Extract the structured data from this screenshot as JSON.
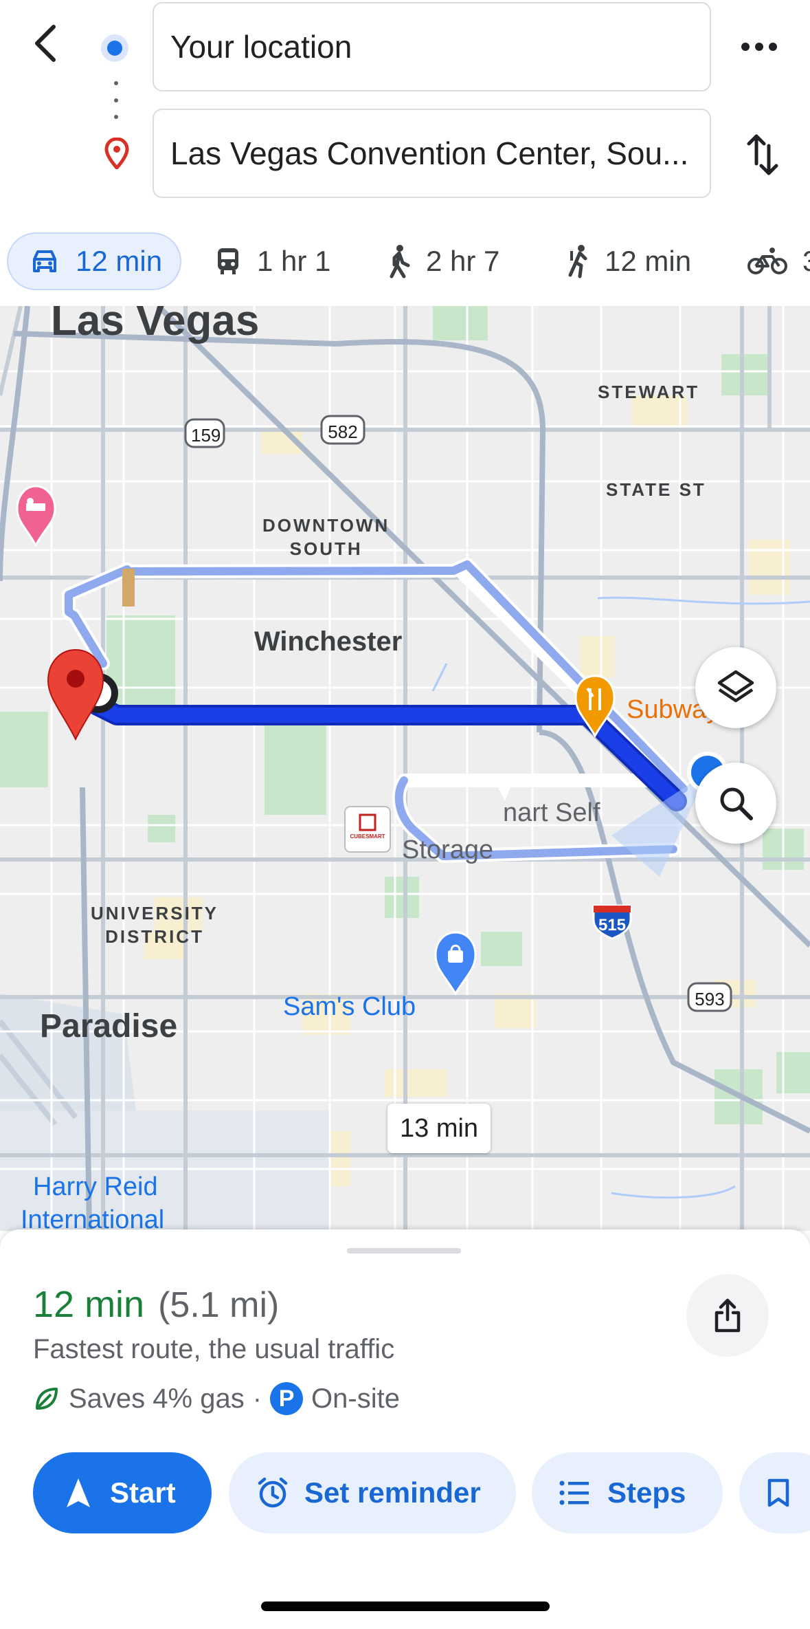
{
  "search": {
    "origin": "Your location",
    "destination": "Las Vegas Convention Center, Sou..."
  },
  "modes": [
    {
      "icon": "car-icon",
      "label": "12 min",
      "active": true
    },
    {
      "icon": "transit-icon",
      "label": "1 hr 1"
    },
    {
      "icon": "walk-icon",
      "label": "2 hr 7"
    },
    {
      "icon": "rideshare-icon",
      "label": "12 min"
    },
    {
      "icon": "bike-icon",
      "label": "3"
    }
  ],
  "map": {
    "labels": {
      "city": "Las Vegas",
      "stewart": "STEWART",
      "state_st": "STATE ST",
      "downtown_south": "DOWNTOWN\nSOUTH",
      "winchester": "Winchester",
      "subway": "Subway",
      "smart_self": "nart Self",
      "storage": "Storage",
      "university_district": "UNIVERSITY\nDISTRICT",
      "sams_club": "Sam's Club",
      "paradise": "Paradise",
      "harry_reid": "Harry Reid",
      "international": "International"
    },
    "shields": {
      "r159": "159",
      "r582": "582",
      "i515": "515",
      "r593": "593"
    },
    "cubesmart_logo_text": "CUBESMART",
    "alt_route_eta": "13 min"
  },
  "summary": {
    "time": "12 min",
    "distance": "(5.1 mi)",
    "description": "Fastest route, the usual traffic",
    "gas": "Saves 4% gas",
    "separator": "·",
    "parking_badge": "P",
    "parking": "On-site"
  },
  "actions": {
    "start": "Start",
    "reminder": "Set reminder",
    "steps": "Steps"
  },
  "colors": {
    "route_primary": "#1a3ee8",
    "route_alt": "#8fa9ef",
    "accent": "#1a73e8",
    "eta_green": "#188038"
  }
}
